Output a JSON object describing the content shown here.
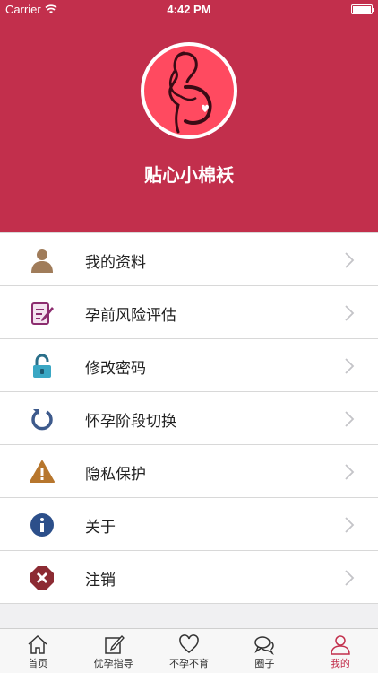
{
  "status": {
    "carrier": "Carrier",
    "time": "4:42 PM"
  },
  "header": {
    "app_name": "贴心小棉袄",
    "accent_color": "#c22f4c"
  },
  "menu": {
    "items": [
      {
        "label": "我的资料",
        "icon": "user-icon"
      },
      {
        "label": "孕前风险评估",
        "icon": "edit-form-icon"
      },
      {
        "label": "修改密码",
        "icon": "unlock-icon"
      },
      {
        "label": "怀孕阶段切换",
        "icon": "refresh-icon"
      },
      {
        "label": "隐私保护",
        "icon": "warning-icon"
      },
      {
        "label": "关于",
        "icon": "info-icon"
      },
      {
        "label": "注销",
        "icon": "logout-icon"
      }
    ]
  },
  "tabs": [
    {
      "label": "首页",
      "icon": "home-icon",
      "active": false
    },
    {
      "label": "优孕指导",
      "icon": "guide-icon",
      "active": false
    },
    {
      "label": "不孕不育",
      "icon": "heart-icon",
      "active": false
    },
    {
      "label": "圈子",
      "icon": "chat-icon",
      "active": false
    },
    {
      "label": "我的",
      "icon": "profile-icon",
      "active": true
    }
  ]
}
